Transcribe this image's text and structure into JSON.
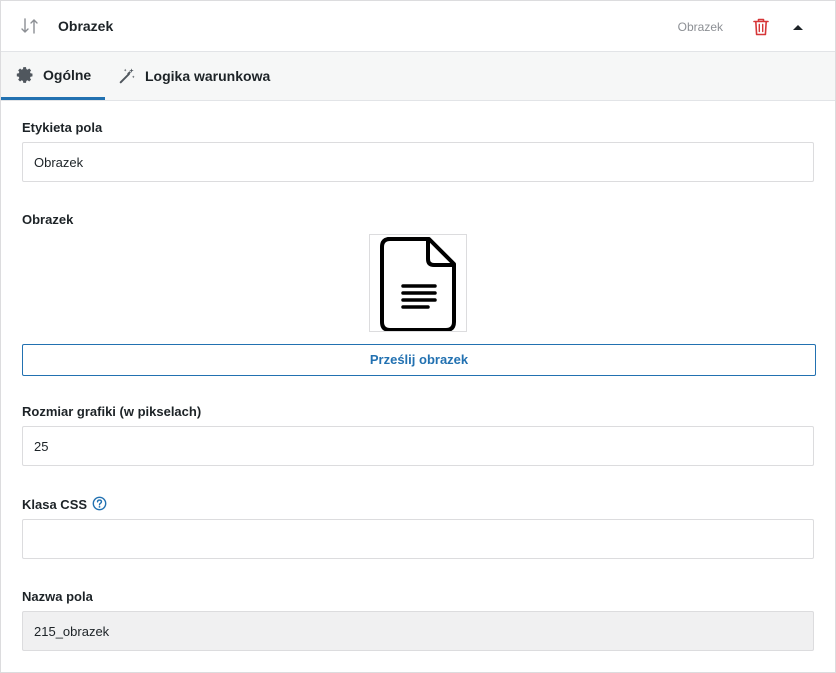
{
  "header": {
    "title": "Obrazek",
    "type_label": "Obrazek",
    "icons": {
      "sort": "sort-arrows-icon",
      "delete": "trash-icon",
      "collapse": "caret-up-icon"
    },
    "colors": {
      "delete": "#d63638"
    }
  },
  "tabs": [
    {
      "label": "Ogólne",
      "icon": "gear-icon",
      "active": true
    },
    {
      "label": "Logika warunkowa",
      "icon": "magic-wand-icon",
      "active": false
    }
  ],
  "fields": {
    "field_label": {
      "label": "Etykieta pola",
      "value": "Obrazek"
    },
    "image": {
      "label": "Obrazek",
      "preview_icon": "document-icon",
      "upload_label": "Prześlij obrazek"
    },
    "image_size": {
      "label": "Rozmiar grafiki (w pikselach)",
      "value": "25"
    },
    "css_class": {
      "label": "Klasa CSS",
      "value": "",
      "help_icon": "help-circle-icon"
    },
    "field_name": {
      "label": "Nazwa pola",
      "value": "215_obrazek"
    }
  },
  "colors": {
    "accent": "#2271b1",
    "tab_background": "#f6f7f7",
    "readonly_background": "#f0f0f1"
  }
}
